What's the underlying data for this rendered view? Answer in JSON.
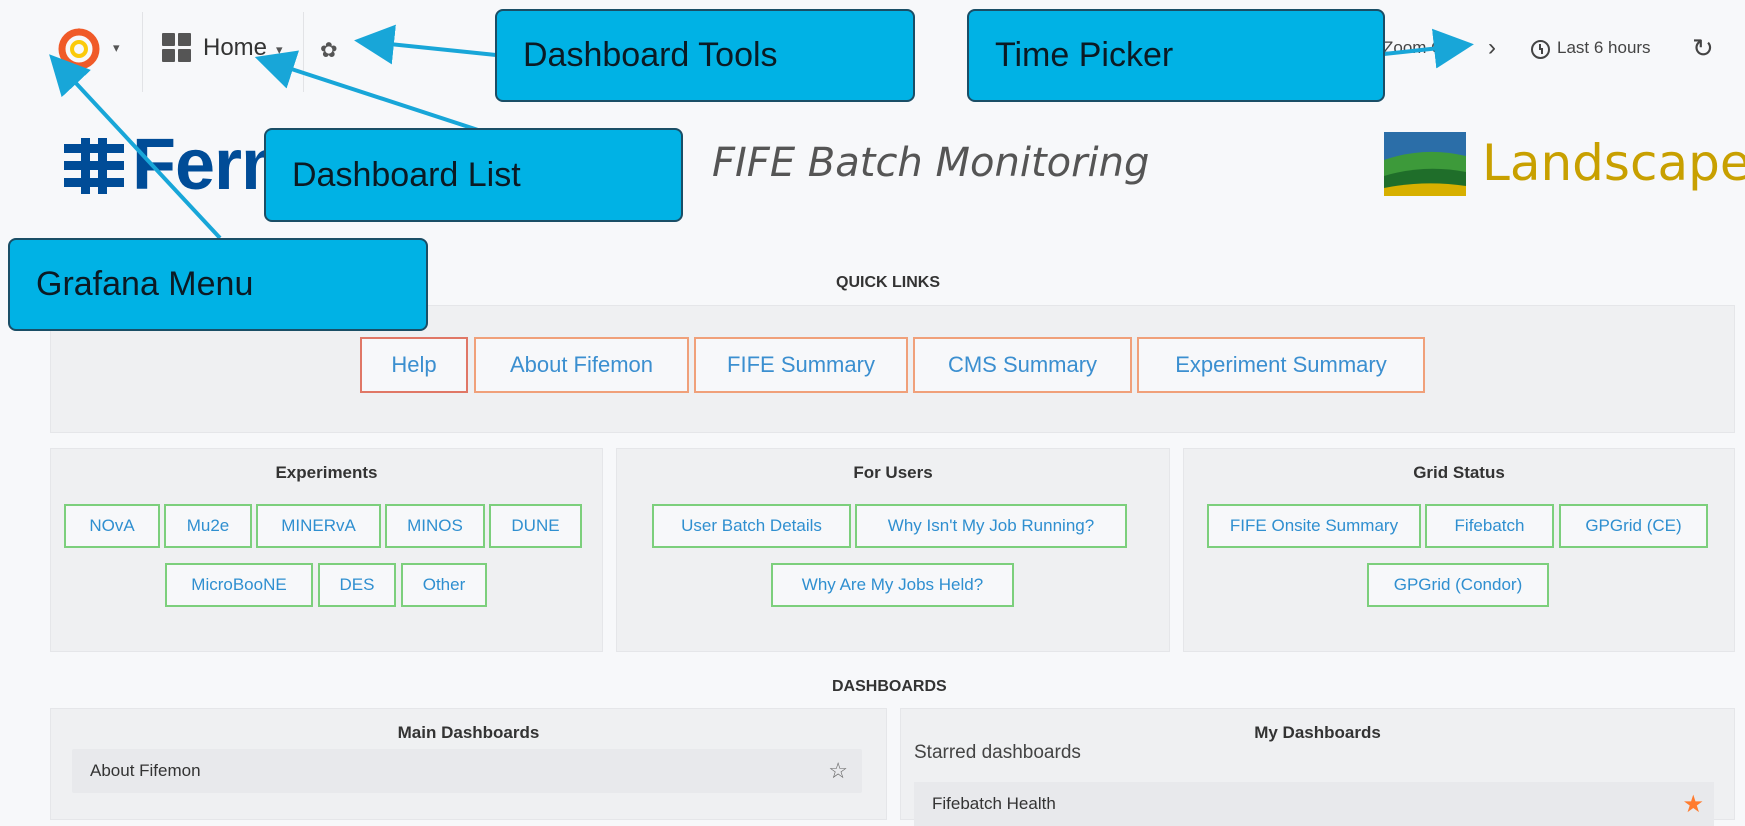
{
  "navbar": {
    "home_label": "Home",
    "zoom_out_label": "Zoom Out",
    "time_range_label": "Last 6 hours",
    "icons": {
      "menu": "grafana-logo-icon",
      "dashboard": "dashboard-grid-icon",
      "settings": "gear-icon",
      "next": "chevron-right-icon",
      "clock": "clock-icon",
      "refresh": "refresh-icon"
    }
  },
  "header": {
    "fermi_text": "Ferm",
    "title": "FIFE Batch Monitoring",
    "landscape_text": "Landscape"
  },
  "quick_links": {
    "title": "QUICK LINKS",
    "buttons": [
      "Help",
      "About Fifemon",
      "FIFE Summary",
      "CMS Summary",
      "Experiment Summary"
    ]
  },
  "experiments": {
    "title": "Experiments",
    "buttons": [
      "NOvA",
      "Mu2e",
      "MINERvA",
      "MINOS",
      "DUNE",
      "MicroBooNE",
      "DES",
      "Other"
    ]
  },
  "for_users": {
    "title": "For Users",
    "buttons": [
      "User Batch Details",
      "Why Isn't My Job Running?",
      "Why Are My Jobs Held?"
    ]
  },
  "grid_status": {
    "title": "Grid Status",
    "buttons": [
      "FIFE Onsite Summary",
      "Fifebatch",
      "GPGrid (CE)",
      "GPGrid (Condor)"
    ]
  },
  "dashboards": {
    "title": "DASHBOARDS",
    "main": {
      "title": "Main Dashboards",
      "rows": [
        "About Fifemon"
      ]
    },
    "mine": {
      "title": "My Dashboards",
      "starred_label": "Starred dashboards",
      "rows": [
        "Fifebatch Health"
      ]
    }
  },
  "callouts": {
    "dashboard_tools": "Dashboard Tools",
    "time_picker": "Time Picker",
    "dashboard_list": "Dashboard List",
    "grafana_menu": "Grafana Menu"
  },
  "colors": {
    "callout_fill": "#00b2e5",
    "callout_border": "#1a4e66",
    "link_text": "#2f8fd0",
    "quick_link_border": "#f0a07a",
    "section_button_border": "#7ccf7c",
    "starred": "#ff7b2e",
    "fermi_blue": "#004c97",
    "landscape_gold": "#c8a000"
  }
}
